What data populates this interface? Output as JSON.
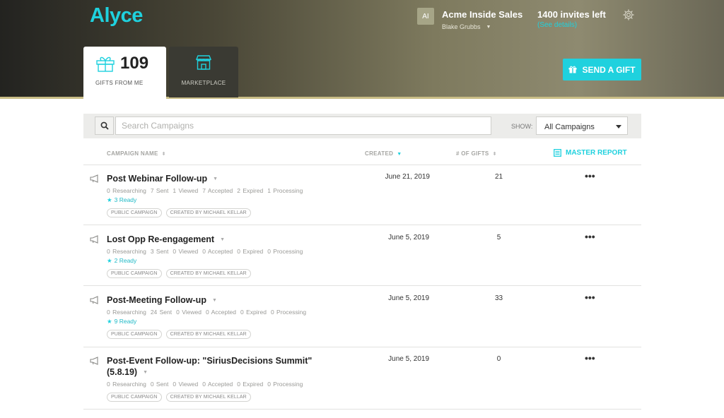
{
  "app": {
    "logo": "Alyce",
    "avatar_initials": "AI",
    "account_name": "Acme Inside Sales",
    "user_name": "Blake Grubbs",
    "invites_left": "1400 invites left",
    "see_details": "(See details)"
  },
  "tabs": {
    "gifts_count": "109",
    "gifts_label": "GIFTS FROM ME",
    "marketplace_label": "MARKETPLACE"
  },
  "send_gift_label": "SEND A GIFT",
  "search": {
    "placeholder": "Search Campaigns",
    "show_label": "SHOW:",
    "show_value": "All Campaigns"
  },
  "columns": {
    "name": "CAMPAIGN NAME",
    "created": "CREATED",
    "gifts": "# OF GIFTS",
    "master_report": "MASTER REPORT"
  },
  "colors": {
    "accent": "#1fd1de"
  },
  "campaigns": [
    {
      "title": "Post Webinar Follow-up",
      "stats": [
        "0 Researching",
        "7 Sent",
        "1 Viewed",
        "7 Accepted",
        "2 Expired",
        "1 Processing"
      ],
      "ready": "3 Ready",
      "tags": [
        "PUBLIC CAMPAIGN",
        "CREATED BY MICHAEL KELLAR"
      ],
      "created": "June 21, 2019",
      "gifts": "21"
    },
    {
      "title": "Lost Opp Re-engagement",
      "stats": [
        "0 Researching",
        "3 Sent",
        "0 Viewed",
        "0 Accepted",
        "0 Expired",
        "0 Processing"
      ],
      "ready": "2 Ready",
      "tags": [
        "PUBLIC CAMPAIGN",
        "CREATED BY MICHAEL KELLAR"
      ],
      "created": "June 5, 2019",
      "gifts": "5"
    },
    {
      "title": "Post-Meeting Follow-up",
      "stats": [
        "0 Researching",
        "24 Sent",
        "0 Viewed",
        "0 Accepted",
        "0 Expired",
        "0 Processing"
      ],
      "ready": "9 Ready",
      "tags": [
        "PUBLIC CAMPAIGN",
        "CREATED BY MICHAEL KELLAR"
      ],
      "created": "June 5, 2019",
      "gifts": "33"
    },
    {
      "title": "Post-Event Follow-up: \"SiriusDecisions Summit\"",
      "title_line2": "(5.8.19)",
      "stats": [
        "0 Researching",
        "0 Sent",
        "0 Viewed",
        "0 Accepted",
        "0 Expired",
        "0 Processing"
      ],
      "tags": [
        "PUBLIC CAMPAIGN",
        "CREATED BY MICHAEL KELLAR"
      ],
      "created": "June 5, 2019",
      "gifts": "0"
    }
  ]
}
